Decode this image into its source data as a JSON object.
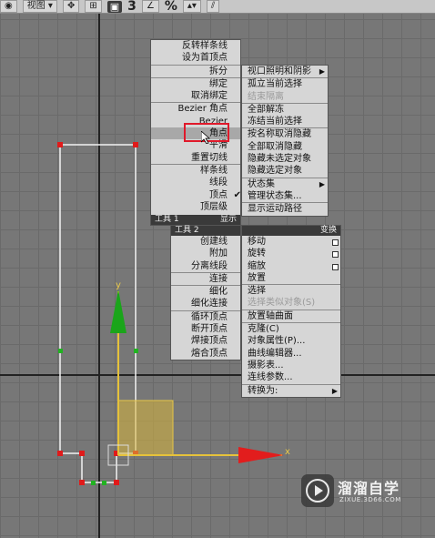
{
  "toolbar": {
    "view_label": "视图",
    "snap_number": "3",
    "percent_label": "%"
  },
  "scene": {
    "gizmo_y_label": "y",
    "gizmo_x_label": "x"
  },
  "menu_top_left": {
    "items": [
      "反转样条线",
      "设为首顶点",
      "拆分",
      "绑定",
      "取消绑定",
      "Bezier 角点",
      "Bezier",
      "角点",
      "平滑",
      "重置切线",
      "样条线",
      "线段",
      "顶点",
      "顶层级"
    ],
    "footer_left": "工具 1",
    "footer_right": "显示"
  },
  "menu_top_right": {
    "items": [
      "视口照明和阴影",
      "孤立当前选择",
      "结束隔离",
      "全部解冻",
      "冻结当前选择",
      "按名称取消隐藏",
      "全部取消隐藏",
      "隐藏未选定对象",
      "隐藏选定对象",
      "状态集",
      "管理状态集...",
      "显示运动路径"
    ]
  },
  "menu_bottom_left": {
    "header_left": "工具 2",
    "items": [
      "创建线",
      "附加",
      "分离线段",
      "连接",
      "细化",
      "细化连接",
      "循环顶点",
      "断开顶点",
      "焊接顶点",
      "熔合顶点"
    ]
  },
  "menu_bottom_right": {
    "header_right": "变换",
    "items": [
      "移动",
      "旋转",
      "缩放",
      "放置",
      "选择",
      "选择类似对象(S)",
      "放置轴曲面",
      "克隆(C)",
      "对象属性(P)...",
      "曲线编辑器...",
      "摄影表...",
      "连线参数...",
      "转换为:"
    ]
  },
  "watermark": {
    "title": "溜溜自学",
    "url": "ZIXUE.3D66.COM"
  }
}
